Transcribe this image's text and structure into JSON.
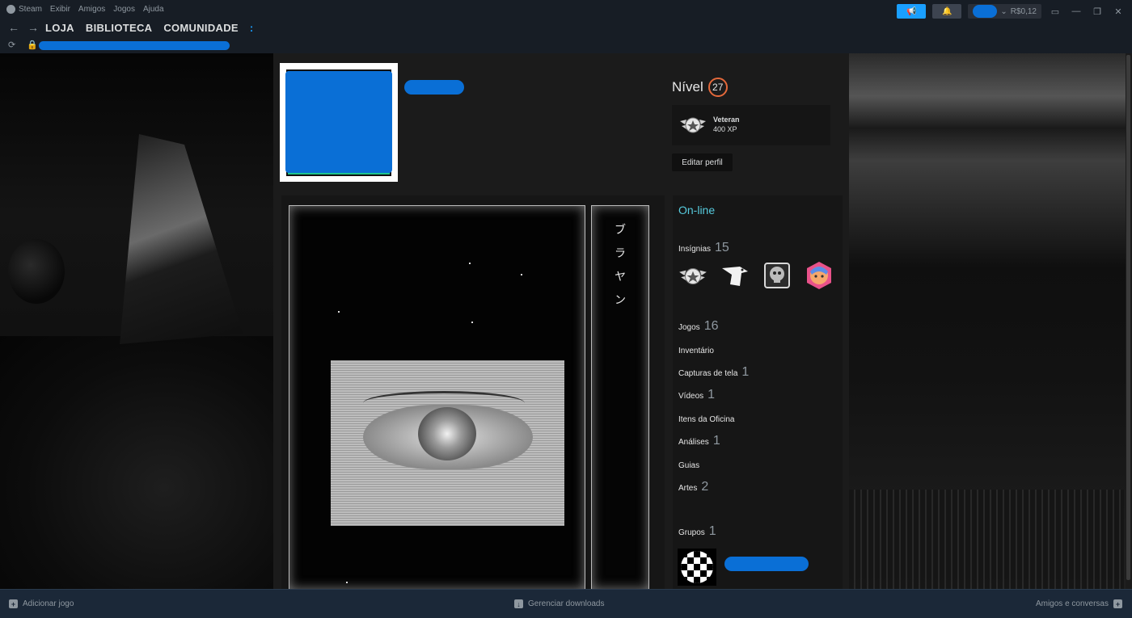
{
  "menu": {
    "app_name": "Steam",
    "items": [
      "Exibir",
      "Amigos",
      "Jogos",
      "Ajuda"
    ]
  },
  "topright": {
    "wallet": "R$0,12"
  },
  "nav": {
    "links": [
      "LOJA",
      "BIBLIOTECA",
      "COMUNIDADE"
    ],
    "extra": ":"
  },
  "profile": {
    "level_label": "Nível",
    "level": "27",
    "xp_badge_name": "Veteran",
    "xp_badge_value": "400 XP",
    "edit_button": "Editar perfil"
  },
  "showcase": {
    "side_text": [
      "ブ",
      "ラ",
      "ヤ",
      "ン"
    ]
  },
  "stats": {
    "status": "On-line",
    "badges_label": "Insígnias",
    "badges_count": "15",
    "games_label": "Jogos",
    "games_count": "16",
    "inventory_label": "Inventário",
    "screenshots_label": "Capturas de tela",
    "screenshots_count": "1",
    "videos_label": "Vídeos",
    "videos_count": "1",
    "workshop_label": "Itens da Oficina",
    "reviews_label": "Análises",
    "reviews_count": "1",
    "guides_label": "Guias",
    "art_label": "Artes",
    "art_count": "2",
    "groups_label": "Grupos",
    "groups_count": "1"
  },
  "bottom": {
    "add_game": "Adicionar jogo",
    "downloads": "Gerenciar downloads",
    "friends": "Amigos e conversas"
  },
  "colors": {
    "accent": "#1a9fff",
    "online": "#57cbde",
    "level_ring": "#e4693b",
    "redaction": "#0a6fd6"
  }
}
